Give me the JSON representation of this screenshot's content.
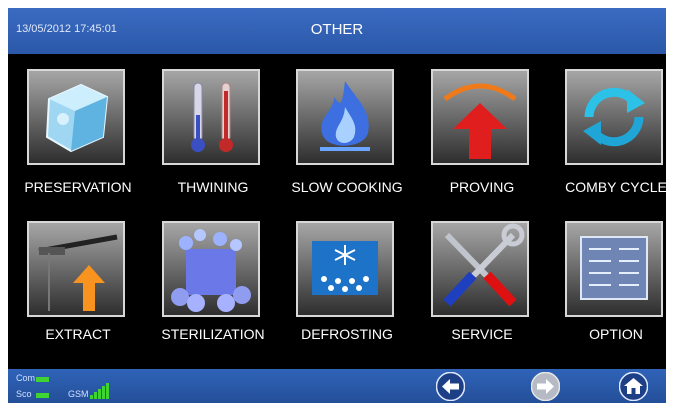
{
  "header": {
    "datetime": "13/05/2012 17:45:01",
    "title": "OTHER"
  },
  "tiles": [
    {
      "label": "PRESERVATION",
      "icon": "ice-cube-icon"
    },
    {
      "label": "THWINING",
      "icon": "thermometers-icon"
    },
    {
      "label": "SLOW COOKING",
      "icon": "flame-icon"
    },
    {
      "label": "PROVING",
      "icon": "rising-arrow-icon"
    },
    {
      "label": "COMBY CYCLE",
      "icon": "cycle-arrows-icon"
    },
    {
      "label": "EXTRACT",
      "icon": "probe-icon"
    },
    {
      "label": "STERILIZATION",
      "icon": "bubbles-icon"
    },
    {
      "label": "DEFROSTING",
      "icon": "snowflake-drops-icon"
    },
    {
      "label": "SERVICE",
      "icon": "tools-icon"
    },
    {
      "label": "OPTION",
      "icon": "checklist-icon"
    }
  ],
  "status": {
    "com_label": "Com",
    "sco_label": "Sco",
    "gsm_label": "GSM",
    "led_color": "#3fd431"
  },
  "nav": {
    "back": "back-arrow-icon",
    "forward": "forward-arrow-icon",
    "home": "home-icon"
  }
}
